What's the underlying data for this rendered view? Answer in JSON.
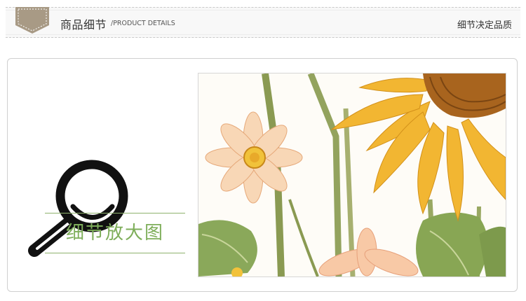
{
  "header": {
    "title_cn": "商品细节",
    "title_en": "/PRODUCT DETAILS",
    "slogan": "细节决定品质"
  },
  "colors": {
    "badge": "#a89a85",
    "accent_green": "#7eae5a",
    "border": "#cfcfcf"
  },
  "detail_panel": {
    "icon": "magnifier-icon",
    "label": "细节放大图"
  },
  "image": {
    "subject": "sunflower-and-cosmos-artwork"
  }
}
